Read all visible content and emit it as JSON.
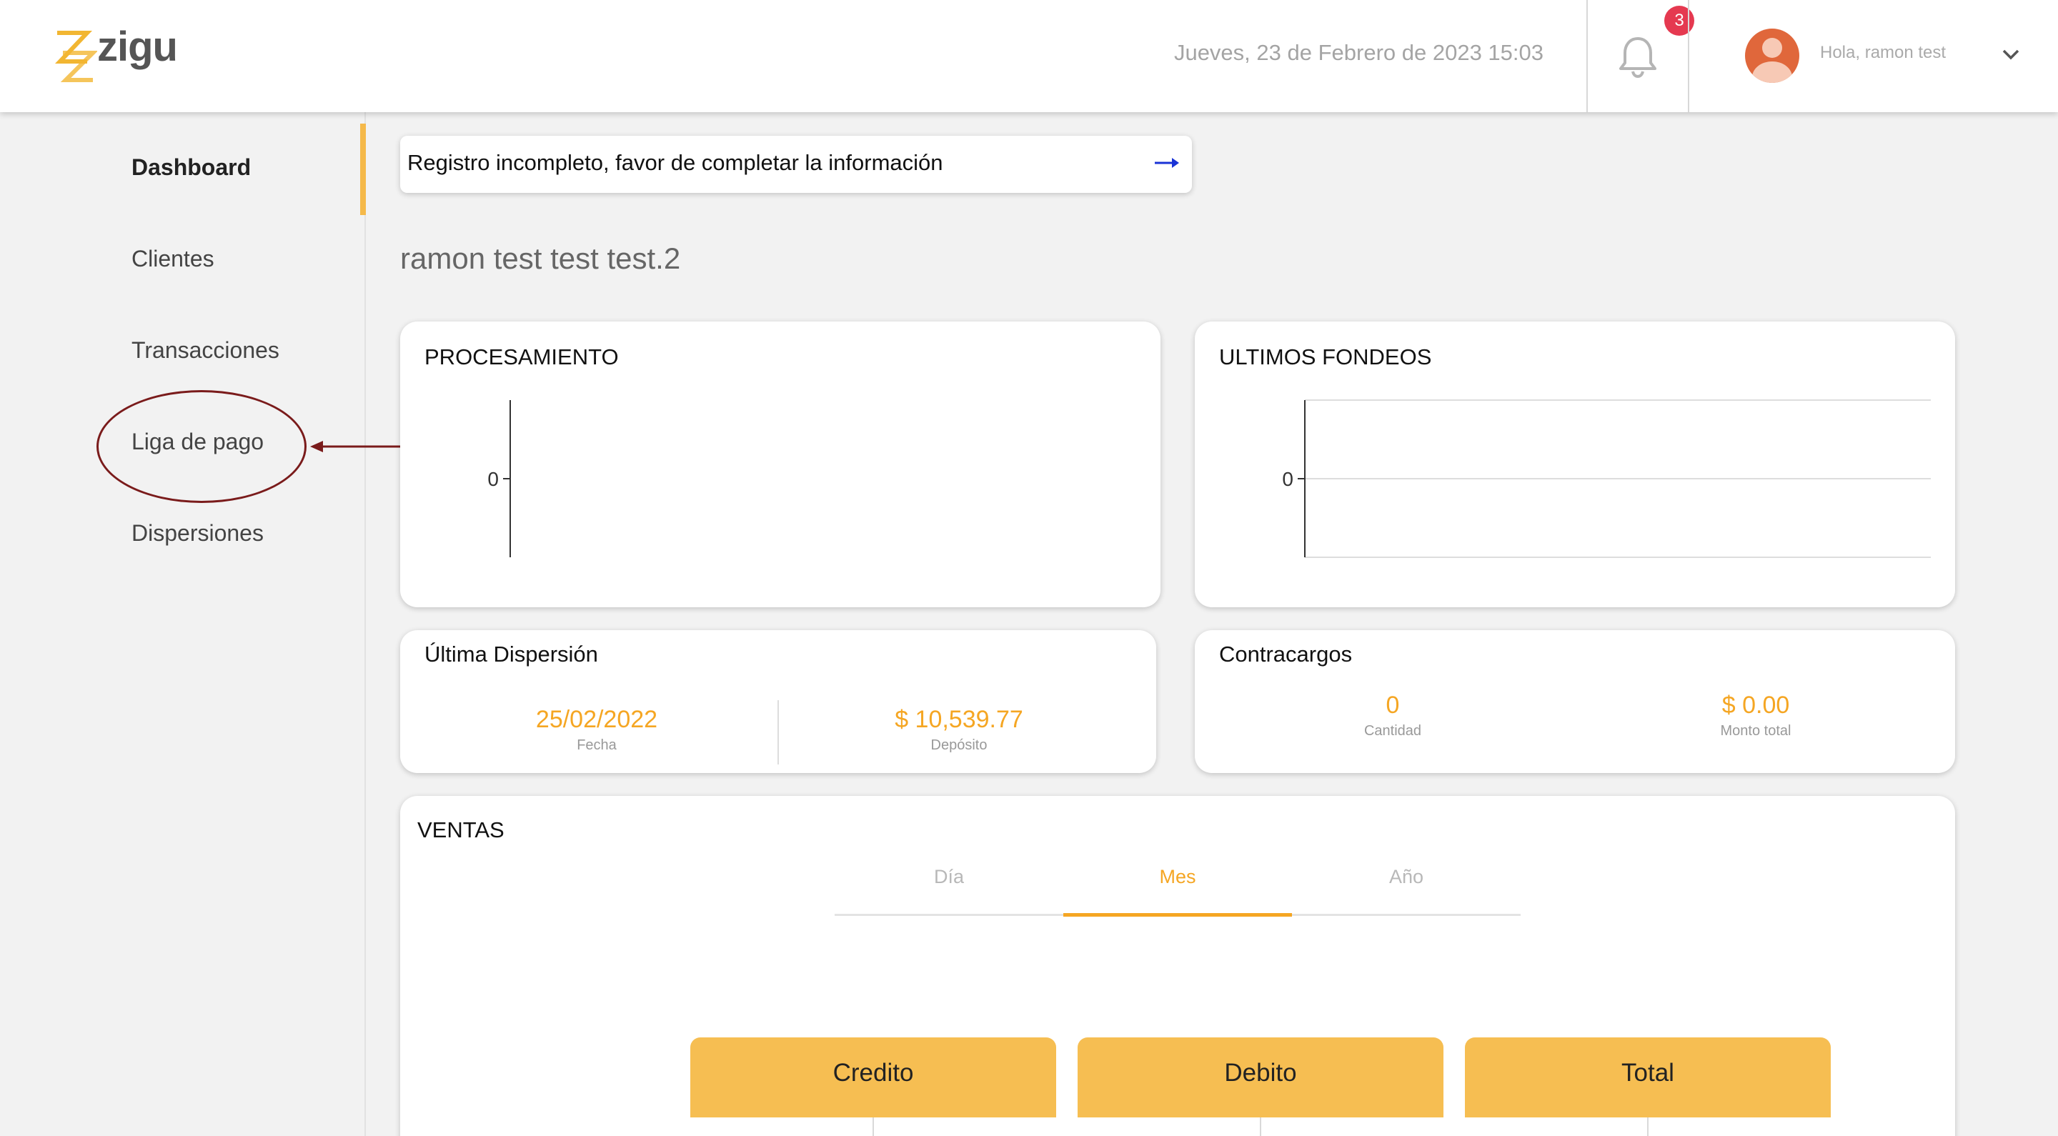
{
  "header": {
    "logo_text": "zigu",
    "datetime": "Jueves, 23 de Febrero de 2023 15:03",
    "notification_count": "3",
    "greeting": "Hola, ramon test"
  },
  "sidebar": {
    "items": [
      {
        "label": "Dashboard"
      },
      {
        "label": "Clientes"
      },
      {
        "label": "Transacciones"
      },
      {
        "label": "Liga de pago"
      },
      {
        "label": "Dispersiones"
      }
    ]
  },
  "alert": {
    "text": "Registro incompleto, favor de completar la información"
  },
  "account_name": "ramon test test test.2",
  "chart_data": [
    {
      "type": "bar",
      "title": "PROCESAMIENTO",
      "categories": [],
      "values": [],
      "y_ticks": [
        "0"
      ],
      "grid": false
    },
    {
      "type": "line",
      "title": "ULTIMOS FONDEOS",
      "categories": [],
      "values": [],
      "y_ticks": [
        "0"
      ],
      "grid": true
    }
  ],
  "ultima_dispersion": {
    "title": "Última Dispersión",
    "fecha_value": "25/02/2022",
    "fecha_label": "Fecha",
    "deposito_value": "$ 10,539.77",
    "deposito_label": "Depósito"
  },
  "contracargos": {
    "title": "Contracargos",
    "cantidad_value": "0",
    "cantidad_label": "Cantidad",
    "monto_value": "$ 0.00",
    "monto_label": "Monto total"
  },
  "ventas": {
    "title": "VENTAS",
    "tabs": [
      {
        "label": "Día"
      },
      {
        "label": "Mes"
      },
      {
        "label": "Año"
      }
    ],
    "columns": [
      {
        "label": "Credito"
      },
      {
        "label": "Debito"
      },
      {
        "label": "Total"
      }
    ]
  },
  "colors": {
    "accent": "#f5a623",
    "column_header": "#f6be52",
    "badge": "#e53950",
    "annotation": "#7a1b1b"
  }
}
